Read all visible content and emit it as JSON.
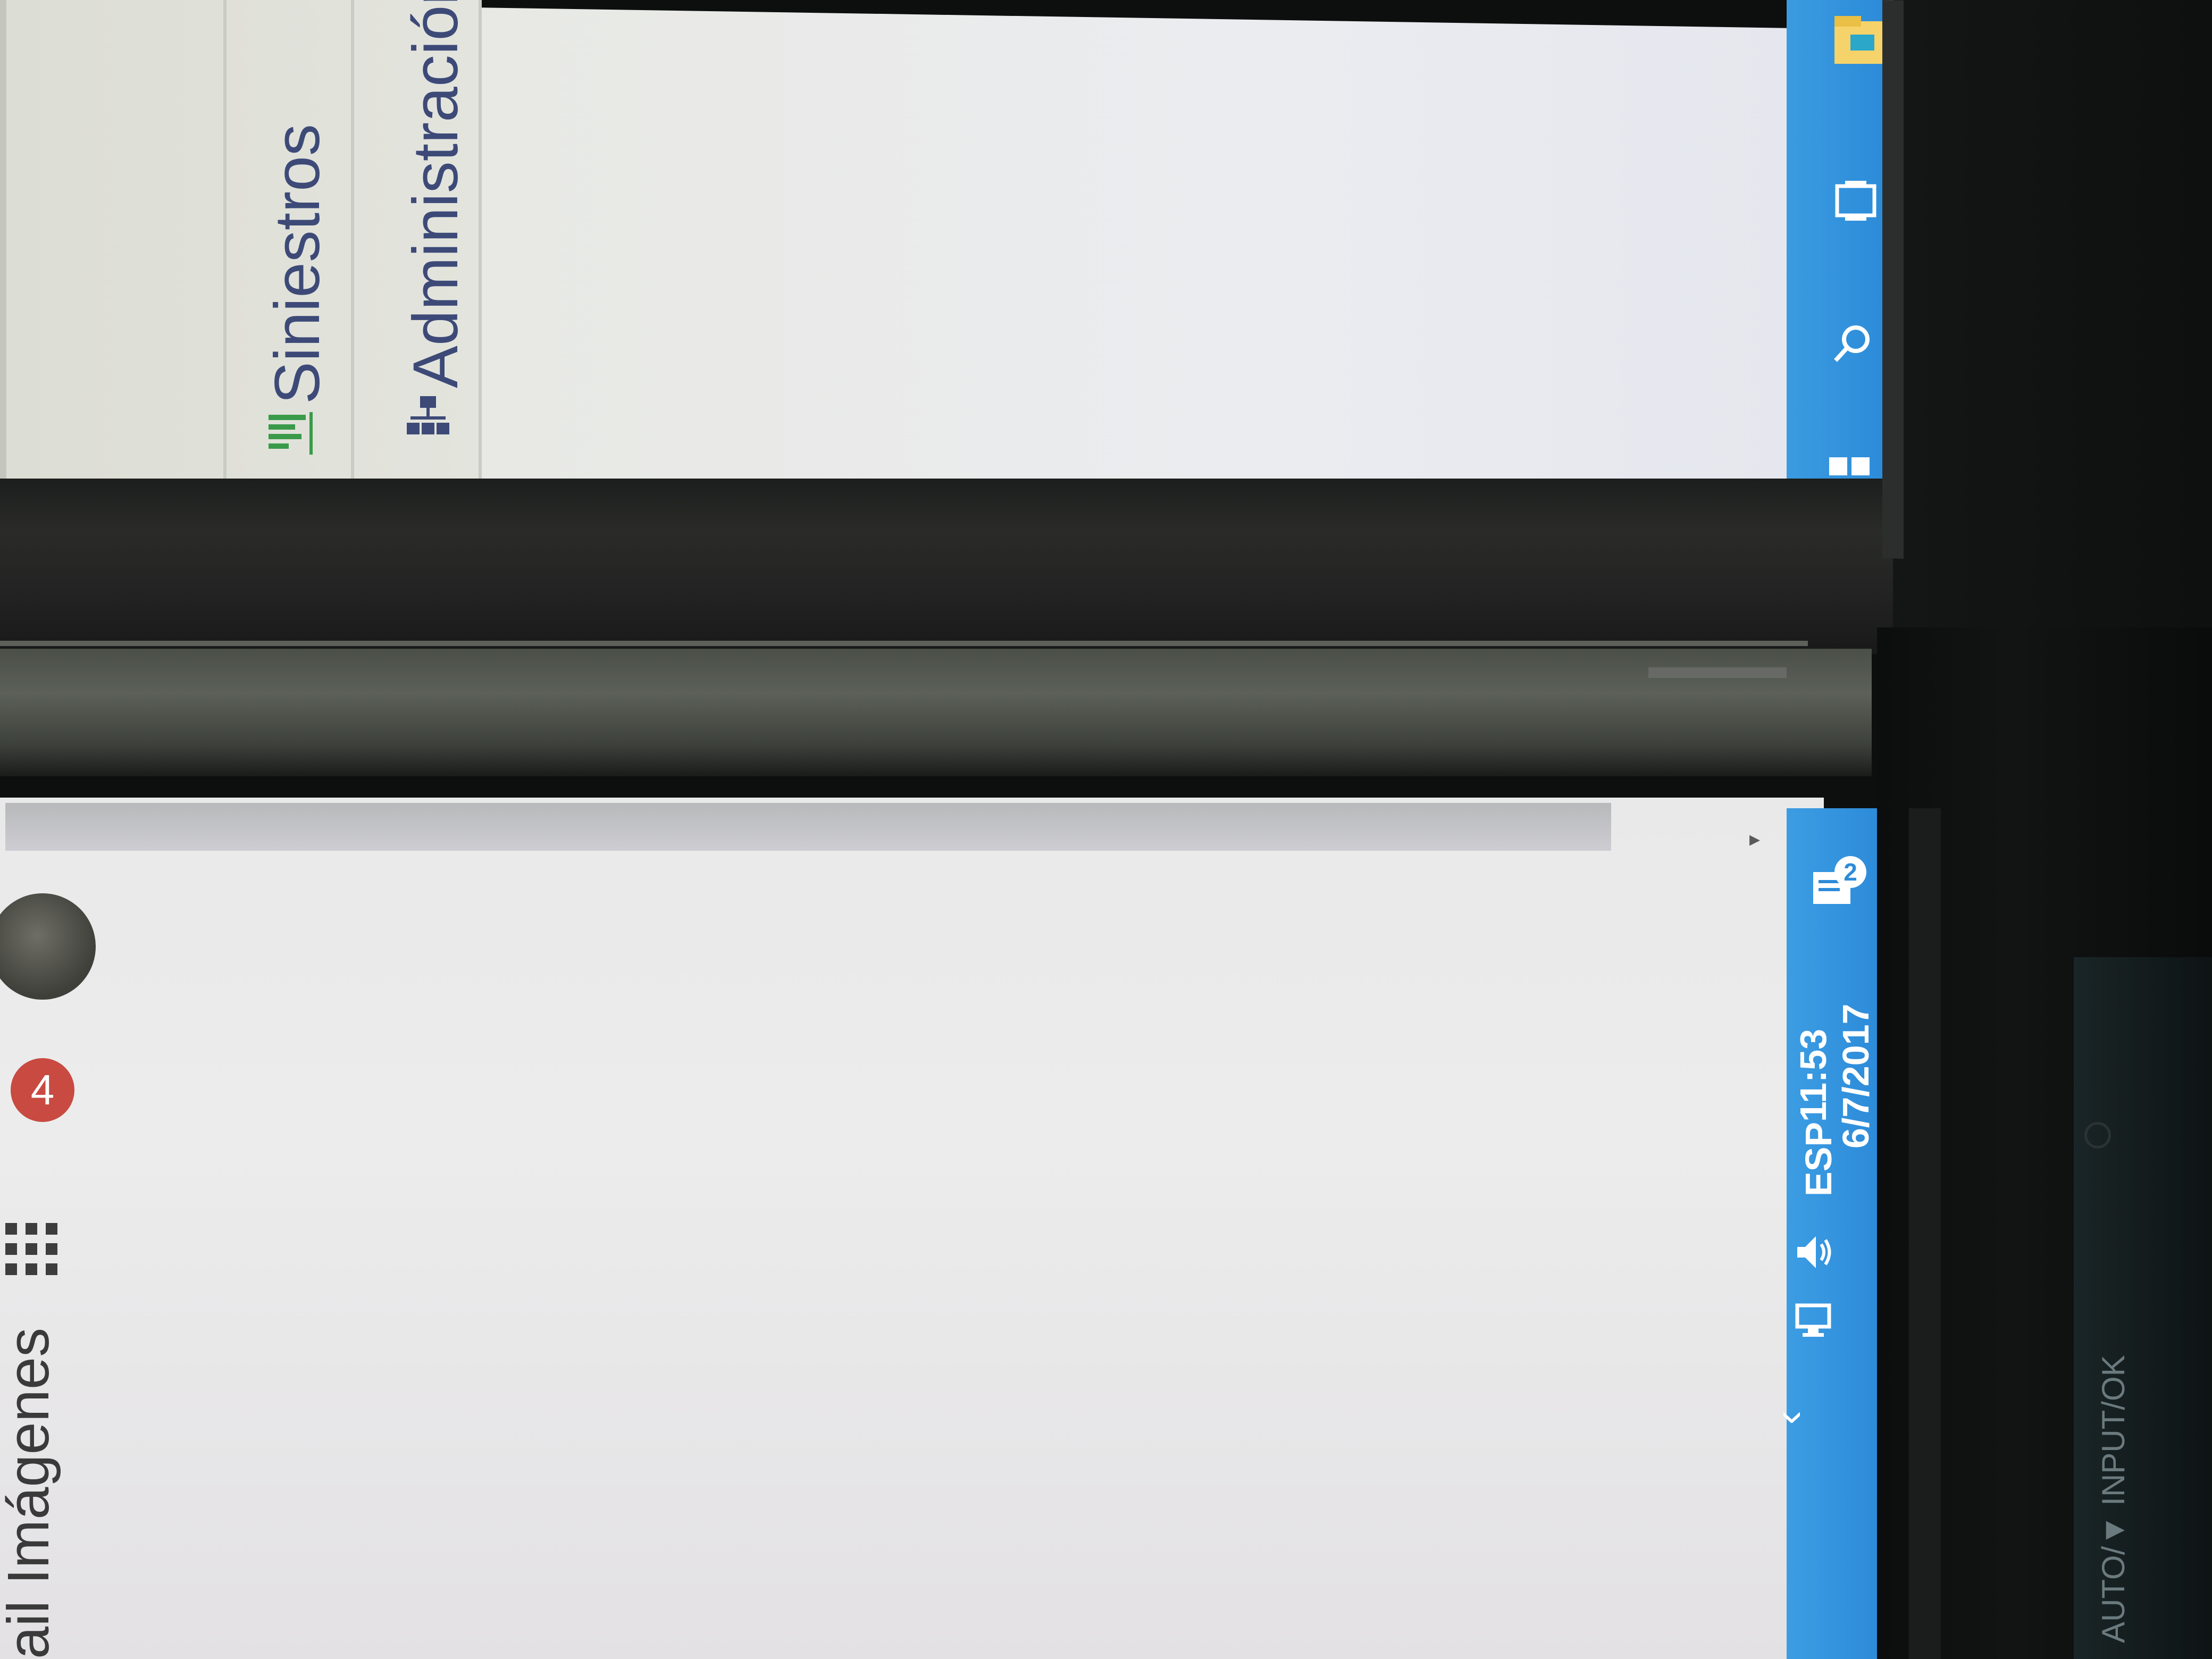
{
  "top_monitor": {
    "nav_items": [
      {
        "label": "Siniestros",
        "icon": "bar-chart-icon"
      },
      {
        "label": "Administración",
        "icon": "sitemap-icon"
      }
    ],
    "taskbar_icons": [
      "windows-start-icon",
      "search-icon",
      "task-view-icon",
      "file-explorer-icon"
    ]
  },
  "bottom_monitor": {
    "google_bar": {
      "link_partial": "ail",
      "images_link": "Imágenes",
      "notifications_count": "4"
    },
    "tray": {
      "language": "ESP",
      "time": "11:53",
      "date": "6/7/2017",
      "notification_center_count": "2"
    }
  },
  "monitor_label": "AUTO/▼ INPUT/OK",
  "colors": {
    "taskbar_blue": "#2f8fdc",
    "badge_red": "#c84a41",
    "menu_text": "#3d4a78",
    "menu_icon_green": "#3a9a4a"
  }
}
